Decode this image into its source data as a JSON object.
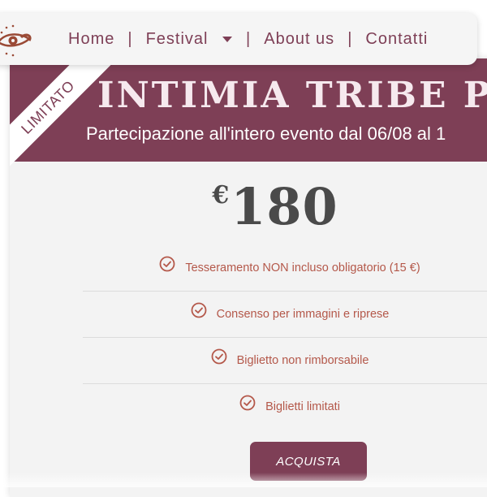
{
  "nav": {
    "home": "Home",
    "festival": "Festival",
    "about": "About us",
    "contacts": "Contatti",
    "separator": "|"
  },
  "card": {
    "ribbon": "LIMITATO",
    "title": "INTIMIA TRIBE PAS",
    "subtitle": "Partecipazione all'intero evento dal 06/08 al 1",
    "currency": "€",
    "price": "180",
    "features": [
      "Tesseramento NON incluso obligatorio (15 €)",
      "Consenso per immagini e riprese",
      "Biglietto non rimborsabile",
      "Biglietti limitati"
    ],
    "button": "ACQUISTA"
  },
  "colors": {
    "brand": "#7e3f56",
    "feature_text": "#b4584a",
    "price_text": "#4a4a4a"
  },
  "icons": {
    "logo": "eye-logo-icon",
    "feature": "check-circle-icon",
    "dropdown": "caret-down-icon"
  }
}
